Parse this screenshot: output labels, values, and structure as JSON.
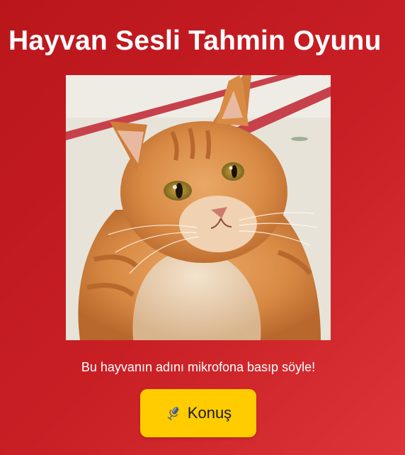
{
  "game": {
    "title": "Hayvan Sesli Tahmin Oyunu",
    "instruction": "Bu hayvanın adını mikrofona basıp söyle!",
    "speak_button_label": "Konuş",
    "speak_button_icon": "microphone-icon",
    "animal_image_icon": "orange-tabby-cat-photo"
  },
  "colors": {
    "background": "#c81f25",
    "title_text": "#ffffff",
    "button_bg": "#ffcc00",
    "button_text": "#1a1a1a"
  }
}
